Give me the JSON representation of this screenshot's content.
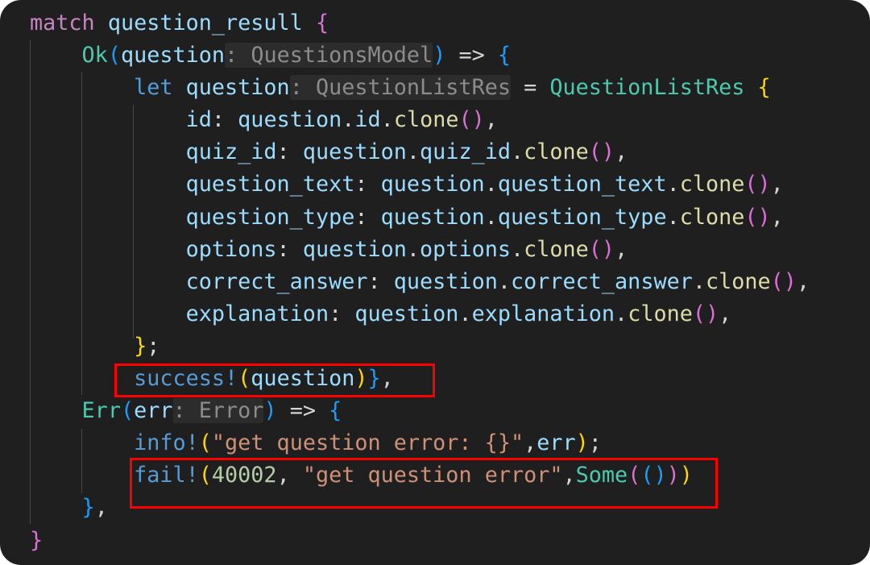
{
  "code_lines": [
    [
      {
        "t": "match ",
        "c": "ctl"
      },
      {
        "t": "question_resull",
        "c": "var"
      },
      {
        "t": " {",
        "c": "b1"
      }
    ],
    [
      {
        "t": "    "
      },
      {
        "t": "Ok",
        "c": "type"
      },
      {
        "t": "(",
        "c": "b2"
      },
      {
        "t": "question",
        "c": "var"
      },
      {
        "t": ": QuestionsModel",
        "c": "hint"
      },
      {
        "t": ")",
        "c": "b2"
      },
      {
        "t": " => ",
        "c": "op"
      },
      {
        "t": "{",
        "c": "b2"
      }
    ],
    [
      {
        "t": "        "
      },
      {
        "t": "let ",
        "c": "kw"
      },
      {
        "t": "question",
        "c": "var"
      },
      {
        "t": ": QuestionListRes",
        "c": "hint"
      },
      {
        "t": " = ",
        "c": "op"
      },
      {
        "t": "QuestionListRes",
        "c": "type"
      },
      {
        "t": " {",
        "c": "b3"
      }
    ],
    [
      {
        "t": "            "
      },
      {
        "t": "id",
        "c": "var"
      },
      {
        "t": ": ",
        "c": "op"
      },
      {
        "t": "question",
        "c": "var"
      },
      {
        "t": ".",
        "c": "op"
      },
      {
        "t": "id",
        "c": "var"
      },
      {
        "t": ".",
        "c": "op"
      },
      {
        "t": "clone",
        "c": "fn"
      },
      {
        "t": "()",
        "c": "b1"
      },
      {
        "t": ",",
        "c": "op"
      }
    ],
    [
      {
        "t": "            "
      },
      {
        "t": "quiz_id",
        "c": "var"
      },
      {
        "t": ": ",
        "c": "op"
      },
      {
        "t": "question",
        "c": "var"
      },
      {
        "t": ".",
        "c": "op"
      },
      {
        "t": "quiz_id",
        "c": "var"
      },
      {
        "t": ".",
        "c": "op"
      },
      {
        "t": "clone",
        "c": "fn"
      },
      {
        "t": "()",
        "c": "b1"
      },
      {
        "t": ",",
        "c": "op"
      }
    ],
    [
      {
        "t": "            "
      },
      {
        "t": "question_text",
        "c": "var"
      },
      {
        "t": ": ",
        "c": "op"
      },
      {
        "t": "question",
        "c": "var"
      },
      {
        "t": ".",
        "c": "op"
      },
      {
        "t": "question_text",
        "c": "var"
      },
      {
        "t": ".",
        "c": "op"
      },
      {
        "t": "clone",
        "c": "fn"
      },
      {
        "t": "()",
        "c": "b1"
      },
      {
        "t": ",",
        "c": "op"
      }
    ],
    [
      {
        "t": "            "
      },
      {
        "t": "question_type",
        "c": "var"
      },
      {
        "t": ": ",
        "c": "op"
      },
      {
        "t": "question",
        "c": "var"
      },
      {
        "t": ".",
        "c": "op"
      },
      {
        "t": "question_type",
        "c": "var"
      },
      {
        "t": ".",
        "c": "op"
      },
      {
        "t": "clone",
        "c": "fn"
      },
      {
        "t": "()",
        "c": "b1"
      },
      {
        "t": ",",
        "c": "op"
      }
    ],
    [
      {
        "t": "            "
      },
      {
        "t": "options",
        "c": "var"
      },
      {
        "t": ": ",
        "c": "op"
      },
      {
        "t": "question",
        "c": "var"
      },
      {
        "t": ".",
        "c": "op"
      },
      {
        "t": "options",
        "c": "var"
      },
      {
        "t": ".",
        "c": "op"
      },
      {
        "t": "clone",
        "c": "fn"
      },
      {
        "t": "()",
        "c": "b1"
      },
      {
        "t": ",",
        "c": "op"
      }
    ],
    [
      {
        "t": "            "
      },
      {
        "t": "correct_answer",
        "c": "var"
      },
      {
        "t": ": ",
        "c": "op"
      },
      {
        "t": "question",
        "c": "var"
      },
      {
        "t": ".",
        "c": "op"
      },
      {
        "t": "correct_answer",
        "c": "var"
      },
      {
        "t": ".",
        "c": "op"
      },
      {
        "t": "clone",
        "c": "fn"
      },
      {
        "t": "()",
        "c": "b1"
      },
      {
        "t": ",",
        "c": "op"
      }
    ],
    [
      {
        "t": "            "
      },
      {
        "t": "explanation",
        "c": "var"
      },
      {
        "t": ": ",
        "c": "op"
      },
      {
        "t": "question",
        "c": "var"
      },
      {
        "t": ".",
        "c": "op"
      },
      {
        "t": "explanation",
        "c": "var"
      },
      {
        "t": ".",
        "c": "op"
      },
      {
        "t": "clone",
        "c": "fn"
      },
      {
        "t": "()",
        "c": "b1"
      },
      {
        "t": ",",
        "c": "op"
      }
    ],
    [
      {
        "t": "        "
      },
      {
        "t": "}",
        "c": "b3"
      },
      {
        "t": ";",
        "c": "op"
      }
    ],
    [
      {
        "t": "        "
      },
      {
        "t": "success!",
        "c": "macro"
      },
      {
        "t": "(",
        "c": "b3"
      },
      {
        "t": "question",
        "c": "var"
      },
      {
        "t": ")",
        "c": "b3"
      },
      {
        "t": "}",
        "c": "b2"
      },
      {
        "t": ",",
        "c": "op"
      }
    ],
    [
      {
        "t": "    "
      },
      {
        "t": "Err",
        "c": "type"
      },
      {
        "t": "(",
        "c": "b2"
      },
      {
        "t": "err",
        "c": "var"
      },
      {
        "t": ": Error",
        "c": "hint"
      },
      {
        "t": ")",
        "c": "b2"
      },
      {
        "t": " => ",
        "c": "op"
      },
      {
        "t": "{",
        "c": "b2"
      }
    ],
    [
      {
        "t": "        "
      },
      {
        "t": "info!",
        "c": "macro"
      },
      {
        "t": "(",
        "c": "b3"
      },
      {
        "t": "\"get question error: {}\"",
        "c": "str"
      },
      {
        "t": ",",
        "c": "op"
      },
      {
        "t": "err",
        "c": "var"
      },
      {
        "t": ")",
        "c": "b3"
      },
      {
        "t": ";",
        "c": "op"
      }
    ],
    [
      {
        "t": "        "
      },
      {
        "t": "fail!",
        "c": "macro"
      },
      {
        "t": "(",
        "c": "b3"
      },
      {
        "t": "40002",
        "c": "num"
      },
      {
        "t": ", ",
        "c": "op"
      },
      {
        "t": "\"get question error\"",
        "c": "str"
      },
      {
        "t": ",",
        "c": "op"
      },
      {
        "t": "Some",
        "c": "type"
      },
      {
        "t": "(",
        "c": "b1"
      },
      {
        "t": "()",
        "c": "b2"
      },
      {
        "t": ")",
        "c": "b1"
      },
      {
        "t": ")",
        "c": "b3"
      }
    ],
    [
      {
        "t": "    "
      },
      {
        "t": "}",
        "c": "b2"
      },
      {
        "t": ",",
        "c": "op"
      }
    ],
    [
      {
        "t": "}",
        "c": "b1"
      }
    ]
  ],
  "highlights": [
    "success-call-highlight",
    "fail-call-highlight"
  ],
  "highlight_color": "#ff0000"
}
